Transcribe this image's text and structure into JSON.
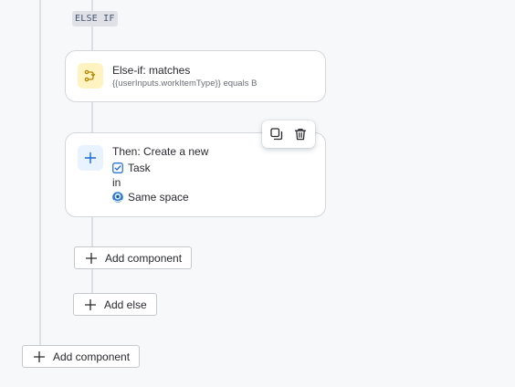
{
  "else_if_tag": "ELSE IF",
  "condition_card": {
    "title": "Else-if: matches",
    "subtitle": "{{userInputs.workItemType}} equals B",
    "icon": "branch-icon"
  },
  "action_card": {
    "title": "Then: Create a new",
    "item_type": "Task",
    "in_label": "in",
    "space": "Same space",
    "icon": "plus-icon"
  },
  "toolbar": {
    "duplicate_icon": "duplicate-icon",
    "delete_icon": "trash-icon"
  },
  "buttons": {
    "add_component_inner": "Add component",
    "add_else": "Add else",
    "add_component_outer": "Add component"
  },
  "colors": {
    "background": "#f7f8f9",
    "connector": "#dcdfe4",
    "condition_icon_bg": "#fff3c2",
    "action_icon_bg": "#e9f2ff",
    "task_blue": "#1868db"
  }
}
